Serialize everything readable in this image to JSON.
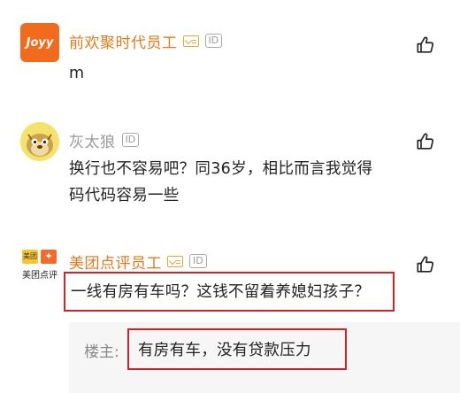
{
  "comments": [
    {
      "username": "前欢聚时代员工",
      "avatar_text": "Joyy",
      "text_lines": [
        "m"
      ],
      "verified": true,
      "id_badge": "ID"
    },
    {
      "username": "灰太狼",
      "avatar_text": "",
      "text_lines": [
        "换行也不容易吧？同36岁，相比而言我觉得",
        "码代码容易一些"
      ],
      "verified": false,
      "id_badge": "ID"
    },
    {
      "username": "美团点评员工",
      "avatar_text_top": "美团",
      "avatar_text_bottom": "美团点评",
      "text_lines": [
        "一线有房有车吗？这钱不留着养媳妇孩子？"
      ],
      "verified": true,
      "id_badge": "ID",
      "reply": {
        "label": "楼主:",
        "text": "有房有车，没有贷款压力"
      }
    }
  ],
  "colors": {
    "company_name": "#e07a1c",
    "highlight_box": "#d2212a",
    "joyy_avatar": "#f26a1b",
    "reply_bg": "#f6f6f6"
  },
  "icons": [
    "thumbs-up-icon",
    "verified-employee-icon",
    "id-badge-icon"
  ]
}
